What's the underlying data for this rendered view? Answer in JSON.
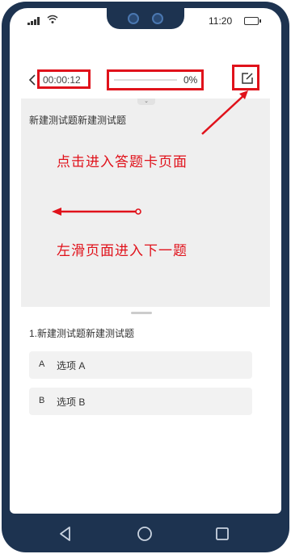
{
  "status_bar": {
    "time": "11:20"
  },
  "toolbar": {
    "timer": "00:00:12",
    "progress_percent": "0%",
    "progress_fraction": 0
  },
  "question_stem": "新建测试题新建测试题",
  "annotations": {
    "answer_card_note": "点击进入答题卡页面",
    "swipe_note": "左滑页面进入下一题"
  },
  "question": {
    "title": "1.新建测试题新建测试题",
    "options": [
      {
        "letter": "A",
        "text": "选项 A"
      },
      {
        "letter": "B",
        "text": "选项 B"
      }
    ]
  },
  "colors": {
    "annotation": "#e0121b",
    "frame": "#1d3350"
  }
}
